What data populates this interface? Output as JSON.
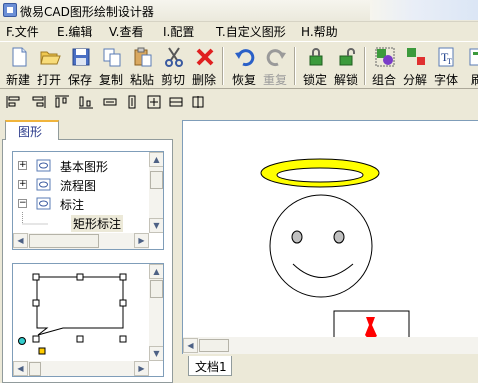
{
  "window": {
    "title": "微易CAD图形绘制设计器"
  },
  "menu": [
    {
      "label": "F.文件"
    },
    {
      "label": "E.编辑"
    },
    {
      "label": "V.查看"
    },
    {
      "label": "I.配置"
    },
    {
      "label": "T.自定义图形"
    },
    {
      "label": "H.帮助"
    }
  ],
  "toolbar": {
    "new": "新建",
    "open": "打开",
    "save": "保存",
    "copy": "复制",
    "paste": "粘贴",
    "cut": "剪切",
    "delete": "删除",
    "undo": "恢复",
    "redo": "重复",
    "lock": "锁定",
    "unlock": "解锁",
    "group": "组合",
    "ungroup": "分解",
    "font": "字体",
    "refresh": "刷"
  },
  "panel": {
    "tab": "图形",
    "tree": [
      {
        "label": "基本图形",
        "expander": "+"
      },
      {
        "label": "流程图",
        "expander": "+"
      },
      {
        "label": "标注",
        "expander": "−"
      },
      {
        "label": "矩形标注",
        "expander": ""
      }
    ]
  },
  "document": {
    "tab": "文档1"
  },
  "colors": {
    "halo": "#ffff00",
    "tie": "#ff0000",
    "eye": "#c0c0c0",
    "selected_tab_accent": "#f0b43c"
  }
}
